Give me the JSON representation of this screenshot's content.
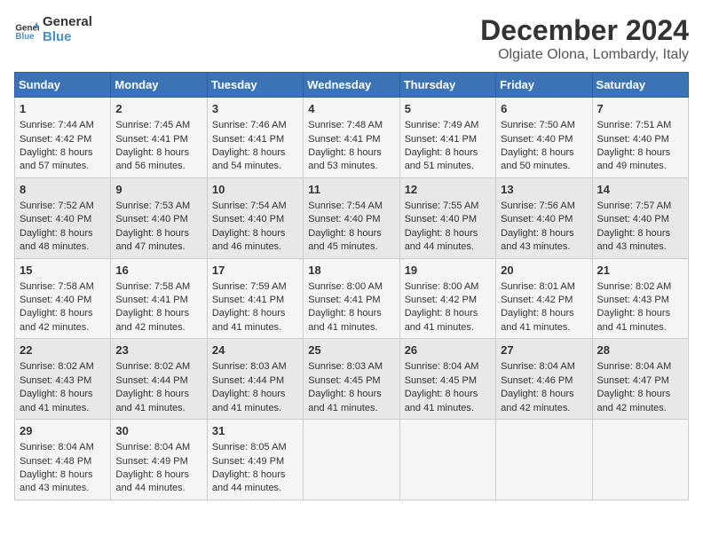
{
  "header": {
    "logo_line1": "General",
    "logo_line2": "Blue",
    "month_title": "December 2024",
    "location": "Olgiate Olona, Lombardy, Italy"
  },
  "days_of_week": [
    "Sunday",
    "Monday",
    "Tuesday",
    "Wednesday",
    "Thursday",
    "Friday",
    "Saturday"
  ],
  "weeks": [
    [
      {
        "day": 1,
        "sunrise": "7:44 AM",
        "sunset": "4:42 PM",
        "daylight": "8 hours and 57 minutes."
      },
      {
        "day": 2,
        "sunrise": "7:45 AM",
        "sunset": "4:41 PM",
        "daylight": "8 hours and 56 minutes."
      },
      {
        "day": 3,
        "sunrise": "7:46 AM",
        "sunset": "4:41 PM",
        "daylight": "8 hours and 54 minutes."
      },
      {
        "day": 4,
        "sunrise": "7:48 AM",
        "sunset": "4:41 PM",
        "daylight": "8 hours and 53 minutes."
      },
      {
        "day": 5,
        "sunrise": "7:49 AM",
        "sunset": "4:41 PM",
        "daylight": "8 hours and 51 minutes."
      },
      {
        "day": 6,
        "sunrise": "7:50 AM",
        "sunset": "4:40 PM",
        "daylight": "8 hours and 50 minutes."
      },
      {
        "day": 7,
        "sunrise": "7:51 AM",
        "sunset": "4:40 PM",
        "daylight": "8 hours and 49 minutes."
      }
    ],
    [
      {
        "day": 8,
        "sunrise": "7:52 AM",
        "sunset": "4:40 PM",
        "daylight": "8 hours and 48 minutes."
      },
      {
        "day": 9,
        "sunrise": "7:53 AM",
        "sunset": "4:40 PM",
        "daylight": "8 hours and 47 minutes."
      },
      {
        "day": 10,
        "sunrise": "7:54 AM",
        "sunset": "4:40 PM",
        "daylight": "8 hours and 46 minutes."
      },
      {
        "day": 11,
        "sunrise": "7:54 AM",
        "sunset": "4:40 PM",
        "daylight": "8 hours and 45 minutes."
      },
      {
        "day": 12,
        "sunrise": "7:55 AM",
        "sunset": "4:40 PM",
        "daylight": "8 hours and 44 minutes."
      },
      {
        "day": 13,
        "sunrise": "7:56 AM",
        "sunset": "4:40 PM",
        "daylight": "8 hours and 43 minutes."
      },
      {
        "day": 14,
        "sunrise": "7:57 AM",
        "sunset": "4:40 PM",
        "daylight": "8 hours and 43 minutes."
      }
    ],
    [
      {
        "day": 15,
        "sunrise": "7:58 AM",
        "sunset": "4:40 PM",
        "daylight": "8 hours and 42 minutes."
      },
      {
        "day": 16,
        "sunrise": "7:58 AM",
        "sunset": "4:41 PM",
        "daylight": "8 hours and 42 minutes."
      },
      {
        "day": 17,
        "sunrise": "7:59 AM",
        "sunset": "4:41 PM",
        "daylight": "8 hours and 41 minutes."
      },
      {
        "day": 18,
        "sunrise": "8:00 AM",
        "sunset": "4:41 PM",
        "daylight": "8 hours and 41 minutes."
      },
      {
        "day": 19,
        "sunrise": "8:00 AM",
        "sunset": "4:42 PM",
        "daylight": "8 hours and 41 minutes."
      },
      {
        "day": 20,
        "sunrise": "8:01 AM",
        "sunset": "4:42 PM",
        "daylight": "8 hours and 41 minutes."
      },
      {
        "day": 21,
        "sunrise": "8:02 AM",
        "sunset": "4:43 PM",
        "daylight": "8 hours and 41 minutes."
      }
    ],
    [
      {
        "day": 22,
        "sunrise": "8:02 AM",
        "sunset": "4:43 PM",
        "daylight": "8 hours and 41 minutes."
      },
      {
        "day": 23,
        "sunrise": "8:02 AM",
        "sunset": "4:44 PM",
        "daylight": "8 hours and 41 minutes."
      },
      {
        "day": 24,
        "sunrise": "8:03 AM",
        "sunset": "4:44 PM",
        "daylight": "8 hours and 41 minutes."
      },
      {
        "day": 25,
        "sunrise": "8:03 AM",
        "sunset": "4:45 PM",
        "daylight": "8 hours and 41 minutes."
      },
      {
        "day": 26,
        "sunrise": "8:04 AM",
        "sunset": "4:45 PM",
        "daylight": "8 hours and 41 minutes."
      },
      {
        "day": 27,
        "sunrise": "8:04 AM",
        "sunset": "4:46 PM",
        "daylight": "8 hours and 42 minutes."
      },
      {
        "day": 28,
        "sunrise": "8:04 AM",
        "sunset": "4:47 PM",
        "daylight": "8 hours and 42 minutes."
      }
    ],
    [
      {
        "day": 29,
        "sunrise": "8:04 AM",
        "sunset": "4:48 PM",
        "daylight": "8 hours and 43 minutes."
      },
      {
        "day": 30,
        "sunrise": "8:04 AM",
        "sunset": "4:49 PM",
        "daylight": "8 hours and 44 minutes."
      },
      {
        "day": 31,
        "sunrise": "8:05 AM",
        "sunset": "4:49 PM",
        "daylight": "8 hours and 44 minutes."
      },
      null,
      null,
      null,
      null
    ]
  ],
  "labels": {
    "sunrise": "Sunrise:",
    "sunset": "Sunset:",
    "daylight": "Daylight:"
  }
}
